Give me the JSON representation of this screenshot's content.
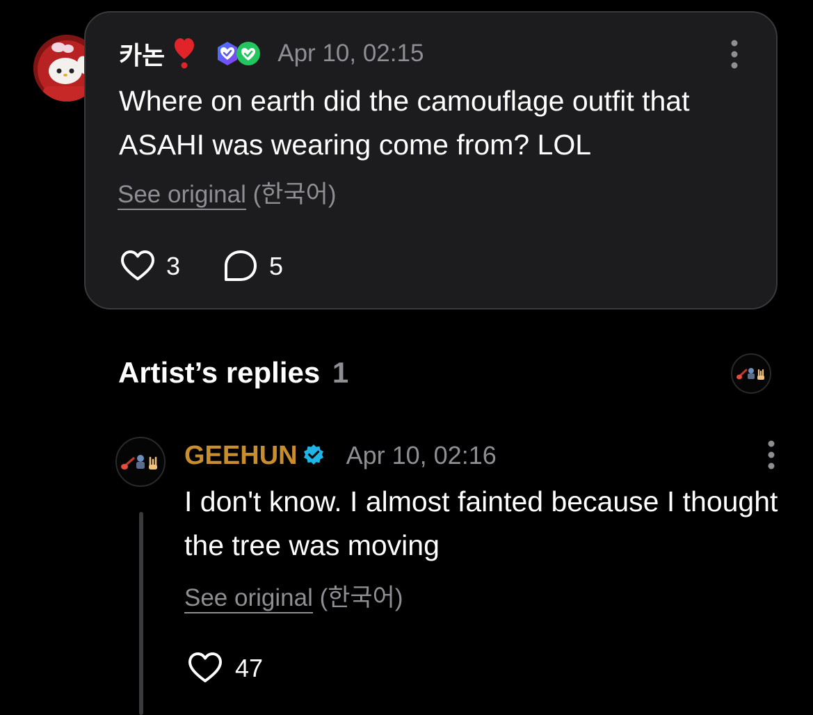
{
  "comment": {
    "author": "카논",
    "author_emoji": "red-exclamation-heart-emoji",
    "badges": [
      "purple-verified-badge-icon",
      "green-verified-badge-icon"
    ],
    "timestamp": "Apr 10, 02:15",
    "text": "Where on earth did the camouflage outfit that ASAHI was wearing come from? LOL",
    "see_original_label": "See original",
    "original_language": "(한국어)",
    "likes": "3",
    "replies": "5"
  },
  "artist_replies": {
    "heading": "Artist’s replies",
    "count": "1"
  },
  "reply": {
    "author": "GEEHUN",
    "author_color": "#c98d2e",
    "verified_color": "#1fb5e6",
    "timestamp": "Apr 10, 02:16",
    "text": "I don't know. I almost fainted because I thought the tree was moving",
    "see_original_label": "See original",
    "original_language": "(한국어)",
    "likes": "47",
    "avatar_emoji": [
      "guitar-emoji",
      "person-emoji",
      "rock-hand-emoji"
    ]
  },
  "colors": {
    "background": "#000000",
    "card_background": "#1c1c1e",
    "muted_text": "#8e8e93"
  }
}
